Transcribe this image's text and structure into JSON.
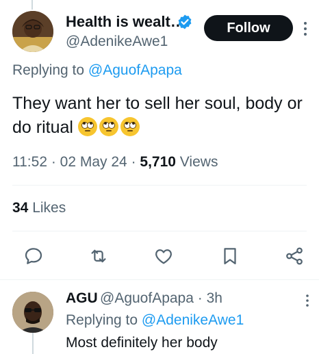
{
  "tweet": {
    "display_name": "Health is wealt…",
    "handle": "@AdenikeAwe1",
    "follow_label": "Follow",
    "replying_prefix": "Replying to ",
    "replying_to": "@AguofApapa",
    "text": "They want her to sell her soul, body or do ritual ",
    "emoji": [
      "face-with-rolling-eyes",
      "face-with-rolling-eyes",
      "face-with-rolling-eyes"
    ],
    "time": "11:52",
    "date": "02 May 24",
    "views_count": "5,710",
    "views_label": " Views",
    "likes_count": "34",
    "likes_label": " Likes"
  },
  "actions": [
    {
      "name": "reply",
      "icon": "comment-icon"
    },
    {
      "name": "retweet",
      "icon": "retweet-icon"
    },
    {
      "name": "like",
      "icon": "heart-icon"
    },
    {
      "name": "bookmark",
      "icon": "bookmark-icon"
    },
    {
      "name": "share",
      "icon": "share-icon"
    }
  ],
  "reply": {
    "display_name": "AGU",
    "handle": "@AguofApapa",
    "time_sep": " · ",
    "time": "3h",
    "replying_prefix": "Replying to ",
    "replying_to": "@AdenikeAwe1",
    "text": "Most definitely her body"
  },
  "colors": {
    "link": "#1d9bf0",
    "muted": "#536471",
    "text": "#0f1419",
    "verified": "#1d9bf0"
  }
}
